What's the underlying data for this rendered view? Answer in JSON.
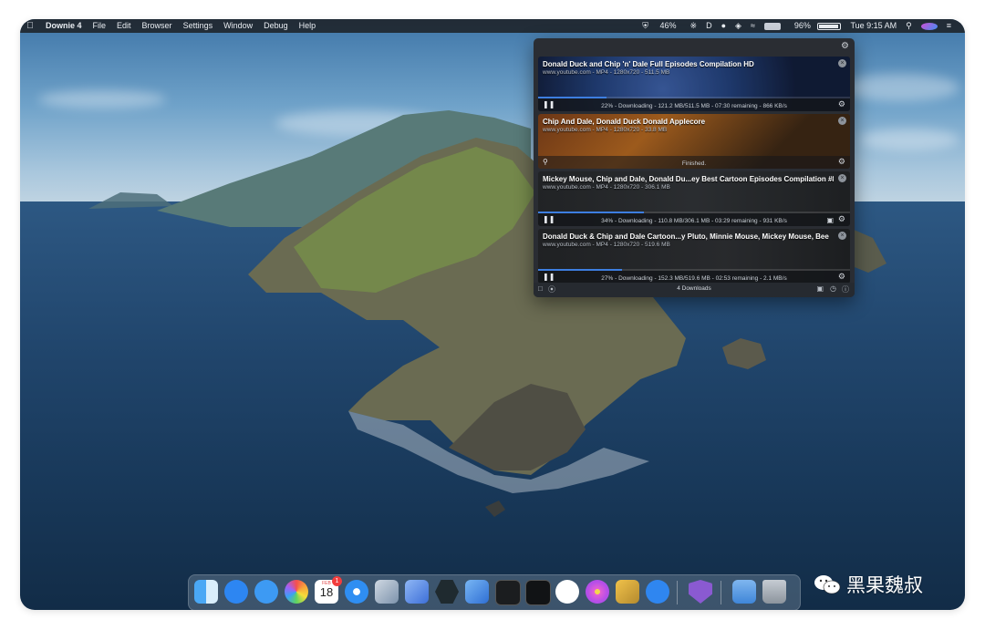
{
  "menubar": {
    "app_name": "Downie 4",
    "menus": [
      "File",
      "Edit",
      "Browser",
      "Settings",
      "Window",
      "Debug",
      "Help"
    ],
    "status": {
      "downie_progress": "46%",
      "battery": "96%",
      "clock": "Tue 9:15 AM"
    }
  },
  "downloads": {
    "items": [
      {
        "title": "Donald Duck and Chip 'n' Dale Full Episodes Compilation HD",
        "subtitle": "www.youtube.com - MP4 - 1280x720 - 511.5 MB",
        "status": "22% - Downloading - 121.2 MB/511.5 MB - 07:30 remaining - 866 KB/s",
        "progress": 0.22,
        "state": "downloading"
      },
      {
        "title": "Chip And Dale, Donald Duck Donald Applecore",
        "subtitle": "www.youtube.com - MP4 - 1280x720 - 33.8 MB",
        "status": "Finished.",
        "progress": 1.0,
        "state": "finished"
      },
      {
        "title": "Mickey Mouse, Chip and Dale, Donald Du...ey Best Cartoon Episodes Compilation #8",
        "subtitle": "www.youtube.com - MP4 - 1280x720 - 306.1 MB",
        "status": "34% - Downloading - 110.8 MB/306.1 MB - 03:29 remaining - 931 KB/s",
        "progress": 0.34,
        "state": "downloading"
      },
      {
        "title": "Donald Duck & Chip and Dale Cartoon...y Pluto, Minnie Mouse, Mickey Mouse, Bee",
        "subtitle": "www.youtube.com - MP4 - 1280x720 - 519.6 MB",
        "status": "27% - Downloading - 152.3 MB/519.6 MB - 02:53 remaining - 2.1 MB/s",
        "progress": 0.27,
        "state": "downloading"
      }
    ],
    "footer_count": "4 Downloads"
  },
  "dock": {
    "calendar_month": "FEB",
    "calendar_day": "18",
    "calendar_badge": "1"
  },
  "watermark": {
    "text": "黑果魏叔"
  },
  "colors": {
    "progress": "#3d7ee0",
    "menubar": "#20262e",
    "panel": "#2a2d33"
  }
}
